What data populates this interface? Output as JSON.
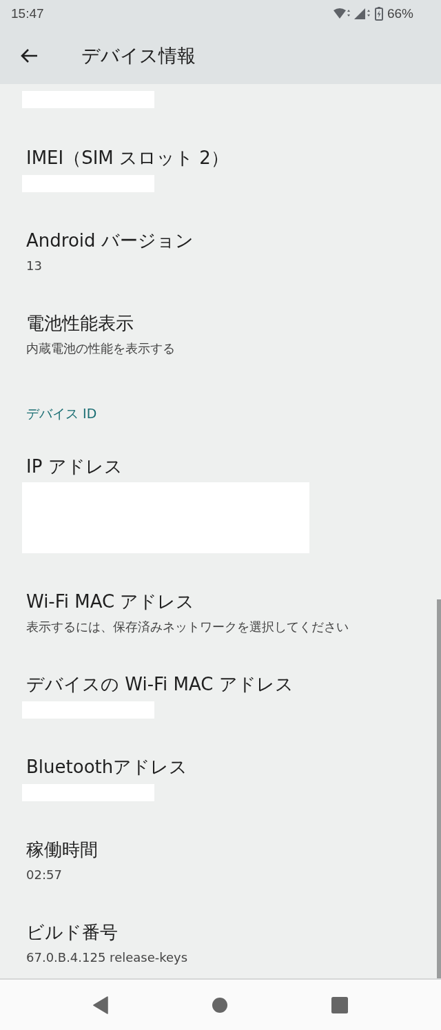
{
  "status_bar": {
    "time": "15:47",
    "battery": "66%"
  },
  "app_bar": {
    "title": "デバイス情報"
  },
  "items": [
    {
      "kind": "redacted"
    },
    {
      "kind": "redacted",
      "title": "IMEI（SIM スロット 2）"
    },
    {
      "kind": "text",
      "title": "Android バージョン",
      "value": "13"
    },
    {
      "kind": "text",
      "title": "電池性能表示",
      "value": "内蔵電池の性能を表示する"
    },
    {
      "kind": "header",
      "title": "デバイス ID"
    },
    {
      "kind": "redacted_block",
      "title": "IP アドレス"
    },
    {
      "kind": "text",
      "title": "Wi-Fi MAC アドレス",
      "value": "表示するには、保存済みネットワークを選択してください"
    },
    {
      "kind": "redacted",
      "title": "デバイスの Wi-Fi MAC アドレス"
    },
    {
      "kind": "redacted",
      "title": "Bluetoothアドレス"
    },
    {
      "kind": "text",
      "title": "稼働時間",
      "value": "02:57"
    },
    {
      "kind": "text",
      "title": "ビルド番号",
      "value": "67.0.B.4.125 release-keys"
    }
  ]
}
